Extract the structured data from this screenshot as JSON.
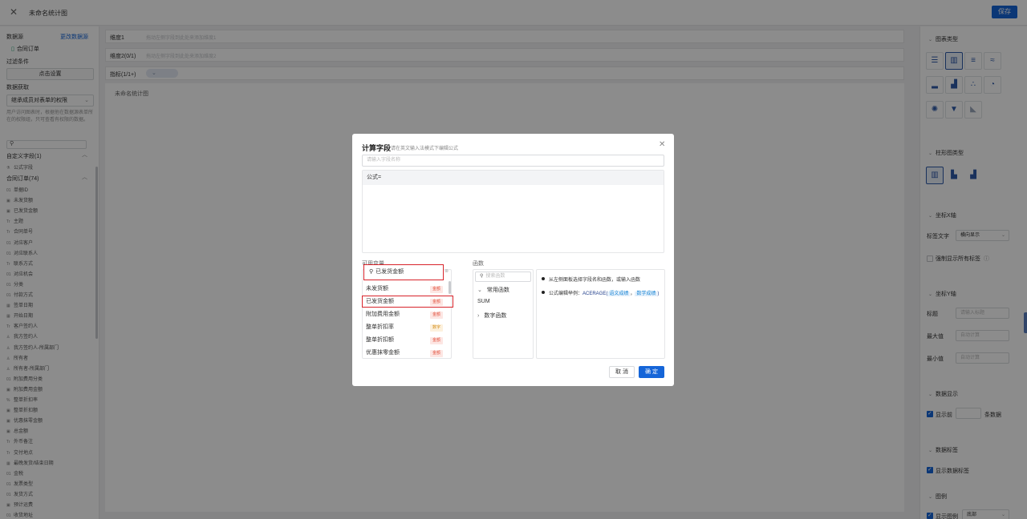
{
  "topbar": {
    "title": "未命名统计图",
    "save_label": "保存"
  },
  "left": {
    "datasource_label": "数据源",
    "change_datasource": "更改数据源",
    "datasource_name": "合同订单",
    "filter_label": "过滤条件",
    "filter_button": "点击设置",
    "fetch_label": "数据获取",
    "fetch_select": "继承成员对表单的权限",
    "fetch_note": "用户访问图表时，根据他在数据源表单所在的权限组，只可查看有权限的数据。",
    "custom_fields": "自定义字段(1)",
    "custom_field_item": "公式字段",
    "order_fields": "合同订单(74)",
    "fields": [
      {
        "icon": "01",
        "label": "单据ID"
      },
      {
        "icon": "▣",
        "label": "未发货额"
      },
      {
        "icon": "▣",
        "label": "已发货金额"
      },
      {
        "icon": "Tr",
        "label": "主题"
      },
      {
        "icon": "Tr",
        "label": "合同单号"
      },
      {
        "icon": "01",
        "label": "对应客户"
      },
      {
        "icon": "01",
        "label": "对应联系人"
      },
      {
        "icon": "Tr",
        "label": "联系方式"
      },
      {
        "icon": "01",
        "label": "对应机会"
      },
      {
        "icon": "01",
        "label": "分类"
      },
      {
        "icon": "01",
        "label": "付款方式"
      },
      {
        "icon": "▦",
        "label": "签单日期"
      },
      {
        "icon": "▦",
        "label": "开始日期"
      },
      {
        "icon": "Tr",
        "label": "客户签约人"
      },
      {
        "icon": "♙",
        "label": "我方签约人"
      },
      {
        "icon": "♙",
        "label": "我方签约人-所属部门"
      },
      {
        "icon": "♙",
        "label": "所有者"
      },
      {
        "icon": "♙",
        "label": "所有者-所属部门"
      },
      {
        "icon": "01",
        "label": "附加费用分类"
      },
      {
        "icon": "▣",
        "label": "附加费用金额"
      },
      {
        "icon": "%",
        "label": "整单折扣率"
      },
      {
        "icon": "▣",
        "label": "整单折扣额"
      },
      {
        "icon": "▣",
        "label": "优惠抹零金额"
      },
      {
        "icon": "▣",
        "label": "总金额"
      },
      {
        "icon": "Tr",
        "label": "外币备注"
      },
      {
        "icon": "Tr",
        "label": "交付地点"
      },
      {
        "icon": "▦",
        "label": "最晚发货/结束日期"
      },
      {
        "icon": "01",
        "label": "金税"
      },
      {
        "icon": "01",
        "label": "发票类型"
      },
      {
        "icon": "01",
        "label": "发货方式"
      },
      {
        "icon": "▣",
        "label": "预计运费"
      },
      {
        "icon": "01",
        "label": "收货地址"
      }
    ]
  },
  "center": {
    "dim1_label": "维度1",
    "dim1_placeholder": "拖动左侧字段到此处来添加维度1",
    "dim2_label": "维度2(0/1)",
    "dim2_placeholder": "拖动左侧字段到此处来添加维度2",
    "metric_label": "指标(1/1+)",
    "canvas_title": "未命名统计图"
  },
  "right": {
    "chart_type_label": "图表类型",
    "bar_type_label": "柱形图类型",
    "xaxis_label": "坐标X轴",
    "label_text": "标签文字",
    "label_text_value": "横向显示",
    "force_show_labels": "强制显示所有标签",
    "yaxis_label": "坐标Y轴",
    "title_label": "标题",
    "title_placeholder": "请输入标题",
    "max_label": "最大值",
    "min_label": "最小值",
    "auto_calc": "自动计算",
    "data_display": "数据显示",
    "show_first": "显示前",
    "rows_unit": "条数据",
    "data_label": "数据标签",
    "show_data_label": "显示数据标签",
    "legend_label": "图例",
    "show_legend": "显示图例",
    "legend_position": "底部"
  },
  "modal": {
    "title": "计算字段",
    "hint": "请在英文输入法模式下编辑公式",
    "name_placeholder": "请输入字段名称",
    "formula_label": "公式=",
    "vars_label": "可用变量",
    "var_search_value": "已发货金额",
    "variables": [
      {
        "name": "未发货额",
        "tag": "金额",
        "kind": "amount"
      },
      {
        "name": "已发货金额",
        "tag": "金额",
        "kind": "amount"
      },
      {
        "name": "附加费用金额",
        "tag": "金额",
        "kind": "amount"
      },
      {
        "name": "整单折扣率",
        "tag": "数字",
        "kind": "number"
      },
      {
        "name": "整单折扣额",
        "tag": "金额",
        "kind": "amount"
      },
      {
        "name": "优惠抹零金额",
        "tag": "金额",
        "kind": "amount"
      }
    ],
    "fn_label": "函数",
    "fn_search_placeholder": "搜索函数",
    "fn_common": "常用函数",
    "fn_sum": "SUM",
    "fn_math": "数字函数",
    "help1": "从左侧面板选择字段名和函数，或输入函数",
    "help2_prefix": "公式编辑举例：",
    "help2_fn": "ACERAGE(",
    "help2_arg1": "语文成绩",
    "help2_sep": "，",
    "help2_arg2": "数学成绩",
    "help2_end": ")",
    "cancel": "取 消",
    "ok": "确 定"
  }
}
